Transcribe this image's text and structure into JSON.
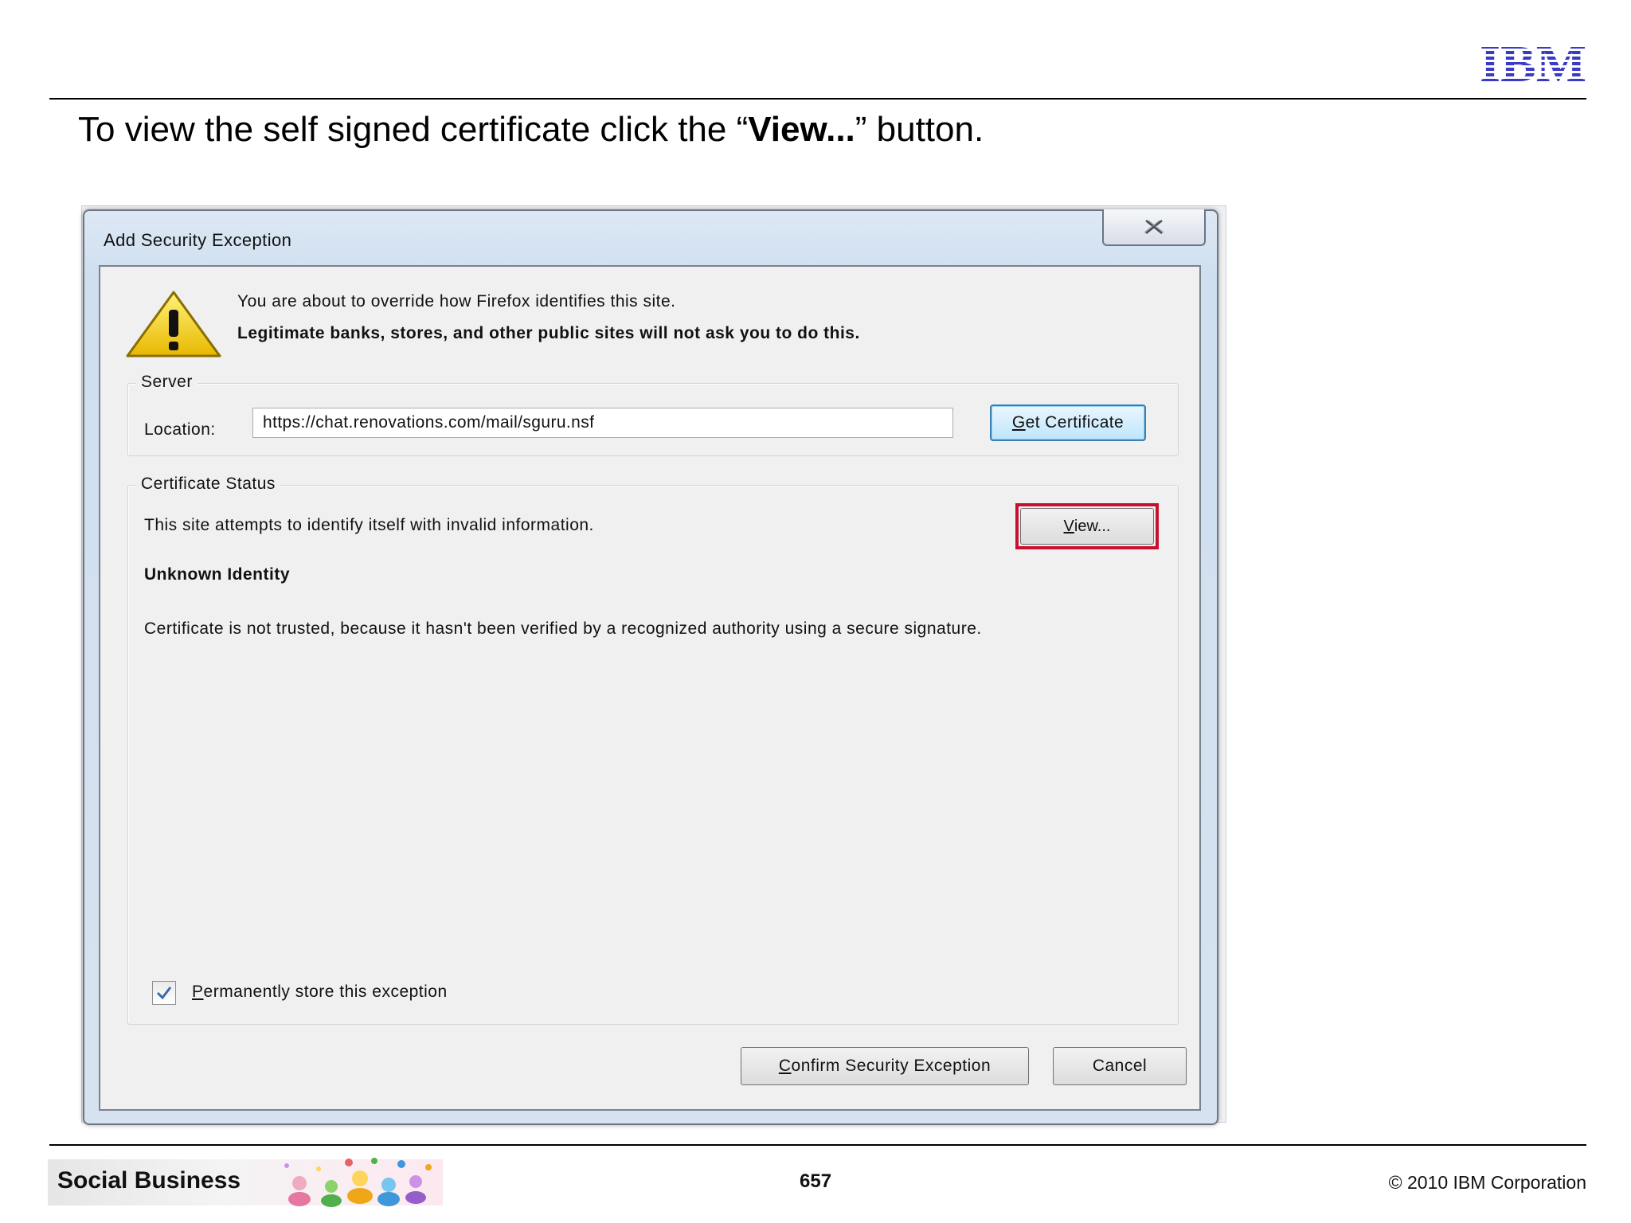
{
  "slide": {
    "logo": "IBM",
    "title_prefix": "To view the self signed certificate click the “",
    "title_bold": "View...",
    "title_suffix": "” button."
  },
  "dialog": {
    "title": "Add Security Exception",
    "close_icon": "close-x-icon",
    "warning_icon": "warning-triangle-icon",
    "warning_line1": "You are about to override how Firefox identifies this site.",
    "warning_line2": "Legitimate banks, stores, and other public sites will not ask you to do this.",
    "server": {
      "legend": "Server",
      "location_label": "Location:",
      "location_value": "https://chat.renovations.com/mail/sguru.nsf",
      "get_certificate_mnemonic": "G",
      "get_certificate_rest": "et Certificate"
    },
    "certificate_status": {
      "legend": "Certificate Status",
      "status_line": "This site attempts to identify itself with invalid information.",
      "view_mnemonic": "V",
      "view_rest": "iew...",
      "identity_heading": "Unknown Identity",
      "detail": "Certificate is not trusted, because it hasn't been verified by a recognized authority using a secure signature."
    },
    "permanent": {
      "checked": true,
      "mnemonic": "P",
      "label_rest": "ermanently store this exception"
    },
    "confirm_mnemonic": "C",
    "confirm_rest": "onfirm Security Exception",
    "cancel_label": "Cancel",
    "highlight_color": "#c8102e"
  },
  "footer": {
    "brand": "Social Business",
    "page_number": "657",
    "copyright": "© 2010 IBM Corporation"
  }
}
